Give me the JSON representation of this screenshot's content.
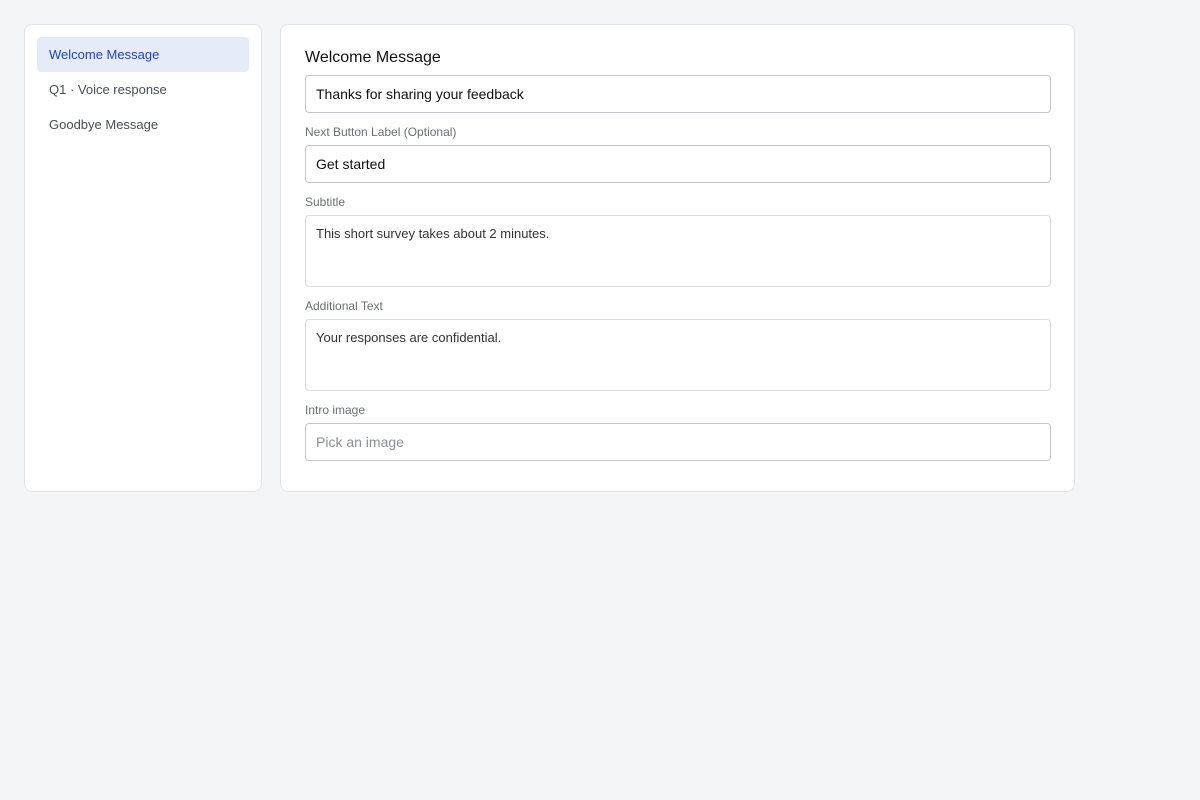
{
  "sidebar": {
    "items": [
      {
        "label": "Welcome Message",
        "active": true
      },
      {
        "label": "Q1 · Voice response",
        "active": false
      },
      {
        "label": "Goodbye Message",
        "active": false
      }
    ]
  },
  "panel": {
    "title": "Welcome Message",
    "title_input": {
      "value": "Thanks for sharing your feedback"
    },
    "next_button_label": {
      "label": "Next Button Label (Optional)",
      "value": "Get started"
    },
    "subtitle": {
      "label": "Subtitle",
      "value": "This short survey takes about 2 minutes."
    },
    "additional_text": {
      "label": "Additional Text",
      "value": "Your responses are confidential."
    },
    "intro_image": {
      "label": "Intro image",
      "placeholder": "Pick an image",
      "value": ""
    }
  },
  "colors": {
    "background": "#f4f5f7",
    "active_item_bg": "#e6ebf8",
    "active_item_text": "#1f45c2"
  }
}
